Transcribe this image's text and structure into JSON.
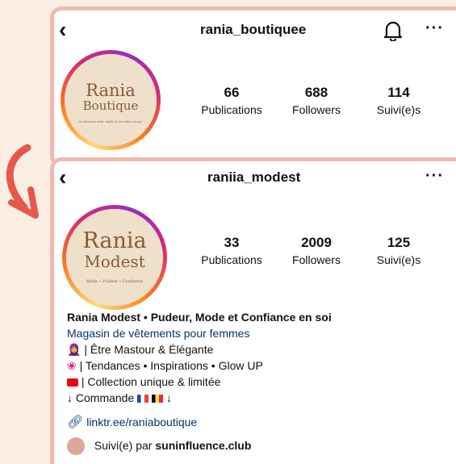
{
  "profile_old": {
    "username": "rania_boutiquee",
    "logo_line1": "Rania",
    "logo_line2": "Boutique",
    "logo_tagline": "La Mousse avec style et un teint cocon.",
    "stats": [
      {
        "value": "66",
        "label": "Publications"
      },
      {
        "value": "688",
        "label": "Followers"
      },
      {
        "value": "114",
        "label": "Suivi(e)s"
      }
    ]
  },
  "profile_new": {
    "username": "raniia_modest",
    "logo_line1": "Rania",
    "logo_line2": "Modest",
    "logo_tagline": "Mode • Pudeur • Confiance",
    "stats": [
      {
        "value": "33",
        "label": "Publications"
      },
      {
        "value": "2009",
        "label": "Followers"
      },
      {
        "value": "125",
        "label": "Suivi(e)s"
      }
    ],
    "bio": {
      "name": "Rania Modest • Pudeur, Mode et Confiance en soi",
      "category": "Magasin de vêtements pour femmes",
      "line1": "| Être Mastour & Élégante",
      "line2": "| Tendances • Inspirations • Glow UP",
      "line3": "| Collection unique & limitée",
      "line4": "↓ Commande",
      "line4_end": "↓",
      "link": "linktr.ee/raniaboutique",
      "followed_by_prefix": "Suivi(e) par ",
      "followed_by_user": "suninfluence.club"
    }
  },
  "colors": {
    "background": "#fbeee3",
    "border": "#f3b8b0",
    "link": "#00376b",
    "arrow": "#e8564c"
  },
  "icons": [
    "back-arrow-icon",
    "bell-icon",
    "more-icon",
    "link-icon",
    "arrow-icon"
  ]
}
